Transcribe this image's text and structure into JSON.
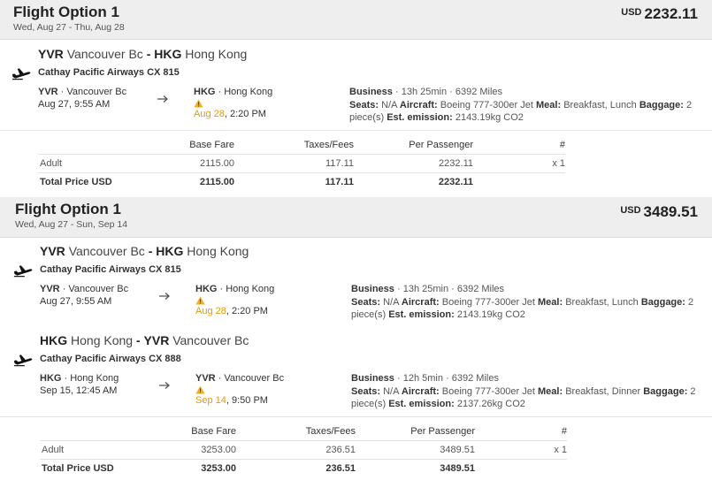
{
  "options": [
    {
      "title": "Flight Option 1",
      "dates": "Wed, Aug 27 - Thu, Aug 28",
      "currency": "USD",
      "price": "2232.11",
      "segments": [
        {
          "from_code": "YVR",
          "from_city": "Vancouver Bc",
          "to_code": "HKG",
          "to_city": "Hong Kong",
          "airline": "Cathay Pacific Airways CX 815",
          "dep_code": "YVR",
          "dep_city": "Vancouver Bc",
          "dep_time": "Aug 27, 9:55 AM",
          "arr_code": "HKG",
          "arr_city": "Hong Kong",
          "arr_date": "Aug 28",
          "arr_clock": ", 2:20 PM",
          "cabin": "Business",
          "duration": "13h 25min",
          "distance": "6392 Miles",
          "seats_label": "Seats:",
          "seats": "N/A",
          "aircraft_label": "Aircraft:",
          "aircraft": "Boeing 777-300er Jet",
          "meal_label": "Meal:",
          "meal": "Breakfast, Lunch",
          "baggage_label": "Baggage:",
          "baggage": "2 piece(s)",
          "emission_label": "Est. emission:",
          "emission": "2143.19kg CO2"
        }
      ],
      "fare": {
        "headers": [
          "",
          "Base Fare",
          "Taxes/Fees",
          "Per Passenger",
          "#"
        ],
        "rows": [
          [
            "Adult",
            "2115.00",
            "117.11",
            "2232.11",
            "x 1"
          ]
        ],
        "total": [
          "Total Price USD",
          "2115.00",
          "117.11",
          "2232.11",
          ""
        ]
      }
    },
    {
      "title": "Flight Option 1",
      "dates": "Wed, Aug 27 - Sun, Sep 14",
      "currency": "USD",
      "price": "3489.51",
      "segments": [
        {
          "from_code": "YVR",
          "from_city": "Vancouver Bc",
          "to_code": "HKG",
          "to_city": "Hong Kong",
          "airline": "Cathay Pacific Airways CX 815",
          "dep_code": "YVR",
          "dep_city": "Vancouver Bc",
          "dep_time": "Aug 27, 9:55 AM",
          "arr_code": "HKG",
          "arr_city": "Hong Kong",
          "arr_date": "Aug 28",
          "arr_clock": ", 2:20 PM",
          "cabin": "Business",
          "duration": "13h 25min",
          "distance": "6392 Miles",
          "seats_label": "Seats:",
          "seats": "N/A",
          "aircraft_label": "Aircraft:",
          "aircraft": "Boeing 777-300er Jet",
          "meal_label": "Meal:",
          "meal": "Breakfast, Lunch",
          "baggage_label": "Baggage:",
          "baggage": "2 piece(s)",
          "emission_label": "Est. emission:",
          "emission": "2143.19kg CO2"
        },
        {
          "from_code": "HKG",
          "from_city": "Hong Kong",
          "to_code": "YVR",
          "to_city": "Vancouver Bc",
          "airline": "Cathay Pacific Airways CX 888",
          "dep_code": "HKG",
          "dep_city": "Hong Kong",
          "dep_time": "Sep 15, 12:45 AM",
          "arr_code": "YVR",
          "arr_city": "Vancouver Bc",
          "arr_date": "Sep 14",
          "arr_clock": ", 9:50 PM",
          "cabin": "Business",
          "duration": "12h 5min",
          "distance": "6392 Miles",
          "seats_label": "Seats:",
          "seats": "N/A",
          "aircraft_label": "Aircraft:",
          "aircraft": "Boeing 777-300er Jet",
          "meal_label": "Meal:",
          "meal": "Breakfast, Dinner",
          "baggage_label": "Baggage:",
          "baggage": "2 piece(s)",
          "emission_label": "Est. emission:",
          "emission": "2137.26kg CO2"
        }
      ],
      "fare": {
        "headers": [
          "",
          "Base Fare",
          "Taxes/Fees",
          "Per Passenger",
          "#"
        ],
        "rows": [
          [
            "Adult",
            "3253.00",
            "236.51",
            "3489.51",
            "x 1"
          ]
        ],
        "total": [
          "Total Price USD",
          "3253.00",
          "236.51",
          "3489.51",
          ""
        ]
      }
    }
  ],
  "icons": {
    "plane": "plane-icon",
    "arrow": "arrow-right-icon",
    "warning": "warning-icon"
  },
  "colors": {
    "header_bg": "#eeeeee",
    "warning": "#f2b01e",
    "date_change": "#e59a00"
  }
}
